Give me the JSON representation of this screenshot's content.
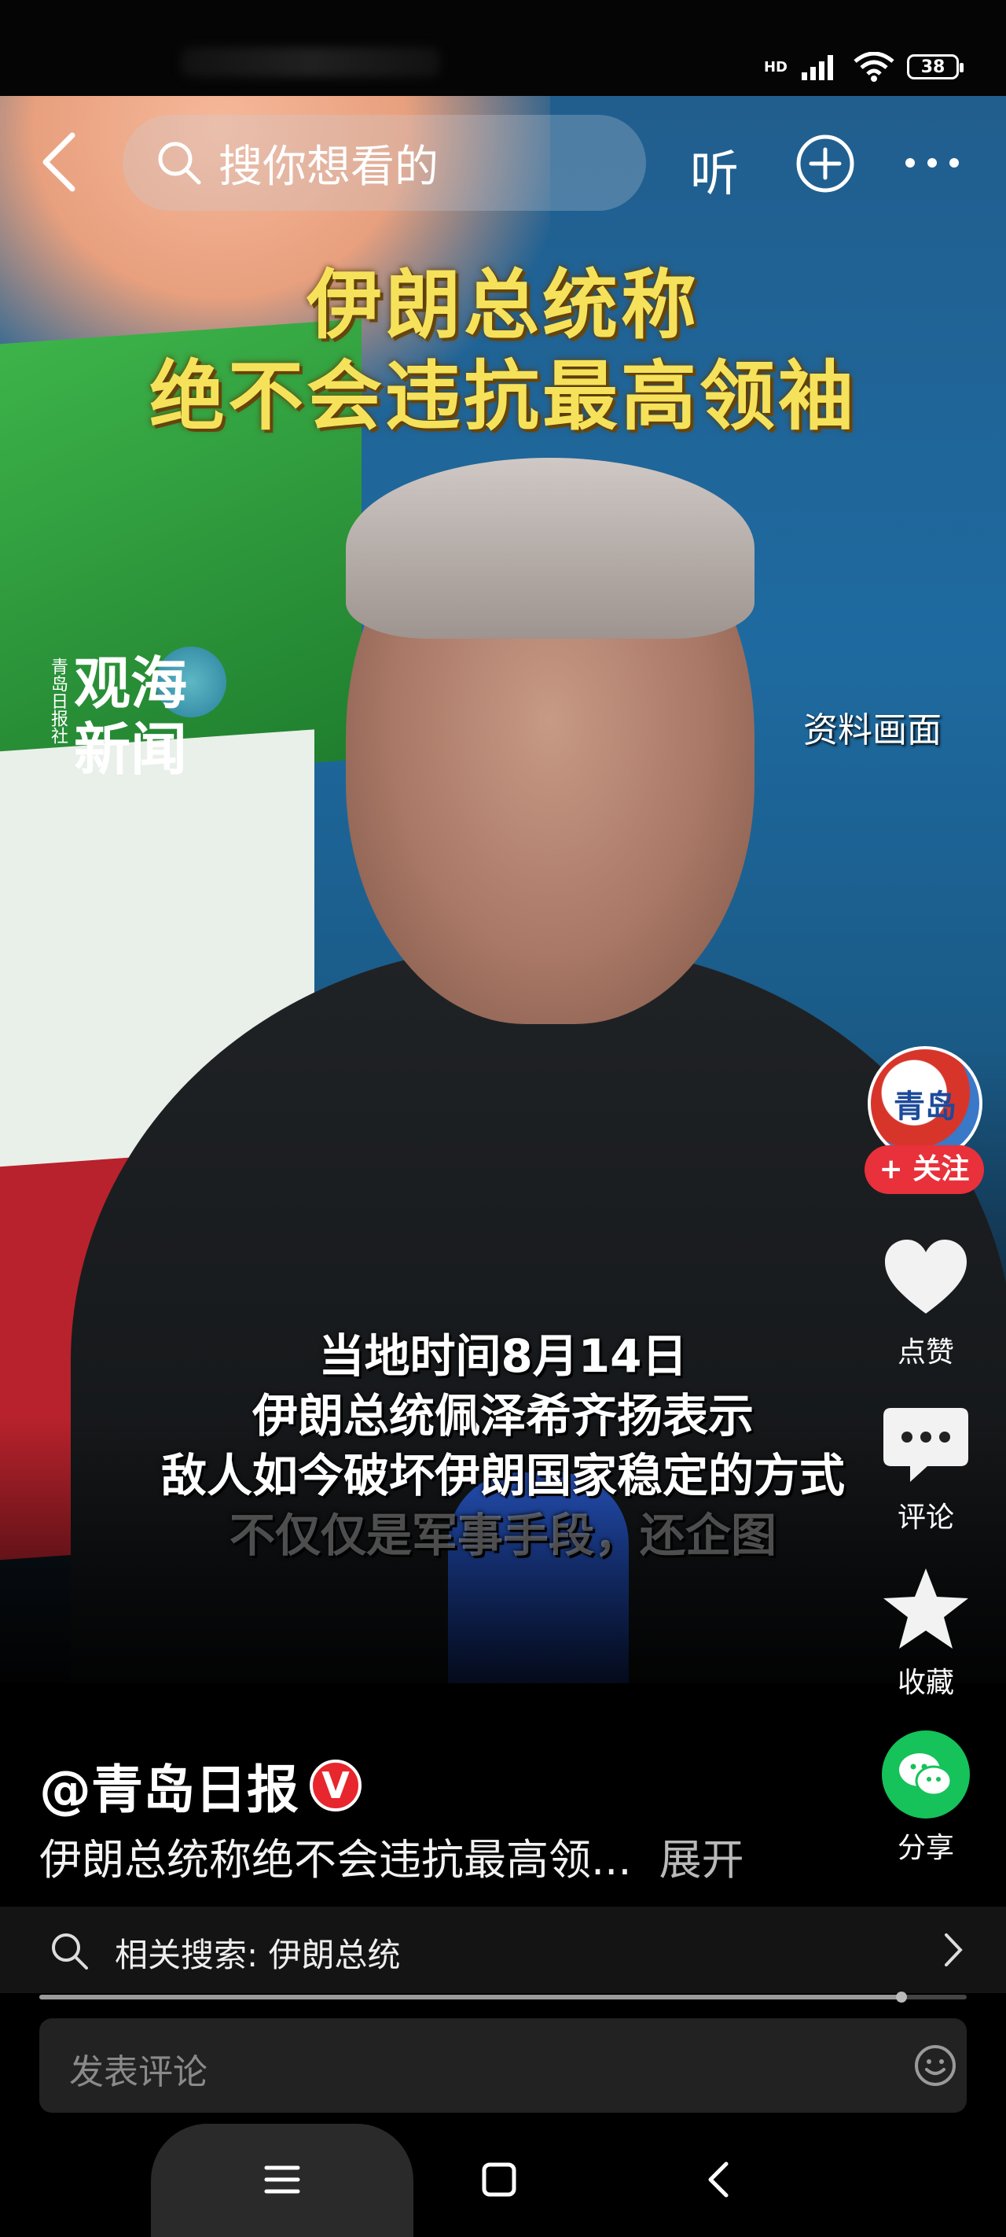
{
  "status_bar": {
    "network": "HD",
    "battery": "38"
  },
  "top_bar": {
    "search_placeholder": "搜你想看的",
    "listen_label": "听"
  },
  "video": {
    "title_line1": "伊朗总统称",
    "title_line2": "绝不会违抗最高领袖",
    "logo_top": "观海",
    "logo_bottom": "新闻",
    "logo_side": "青岛日报社",
    "archive_label": "资料画面",
    "subtitles": [
      "当地时间8月14日",
      "伊朗总统佩泽希齐扬表示",
      "敌人如今破坏伊朗国家稳定的方式",
      "不仅仅是军事手段，还企图"
    ]
  },
  "side_actions": {
    "avatar_text": "青岛",
    "follow_label": "+ 关注",
    "like_label": "点赞",
    "comment_label": "评论",
    "favorite_label": "收藏",
    "share_label": "分享"
  },
  "post": {
    "author": "@青岛日报",
    "verified_badge": "V",
    "description": "伊朗总统称绝不会违抗最高领...",
    "expand_label": "展开"
  },
  "related_search": {
    "label": "相关搜索: 伊朗总统"
  },
  "playback": {
    "progress": 0.93
  },
  "comment_bar": {
    "placeholder": "发表评论"
  },
  "colors": {
    "follow": "#e8313b",
    "verified": "#e8262e",
    "wechat": "#16c25a",
    "title_yellow": "#f6e25a"
  },
  "icons": [
    "back-icon",
    "search-icon",
    "plus-icon",
    "more-icon",
    "heart-icon",
    "comment-icon",
    "star-icon",
    "wechat-icon",
    "chevron-right-icon",
    "emoji-icon",
    "menu-icon",
    "home-icon",
    "nav-back-icon"
  ]
}
